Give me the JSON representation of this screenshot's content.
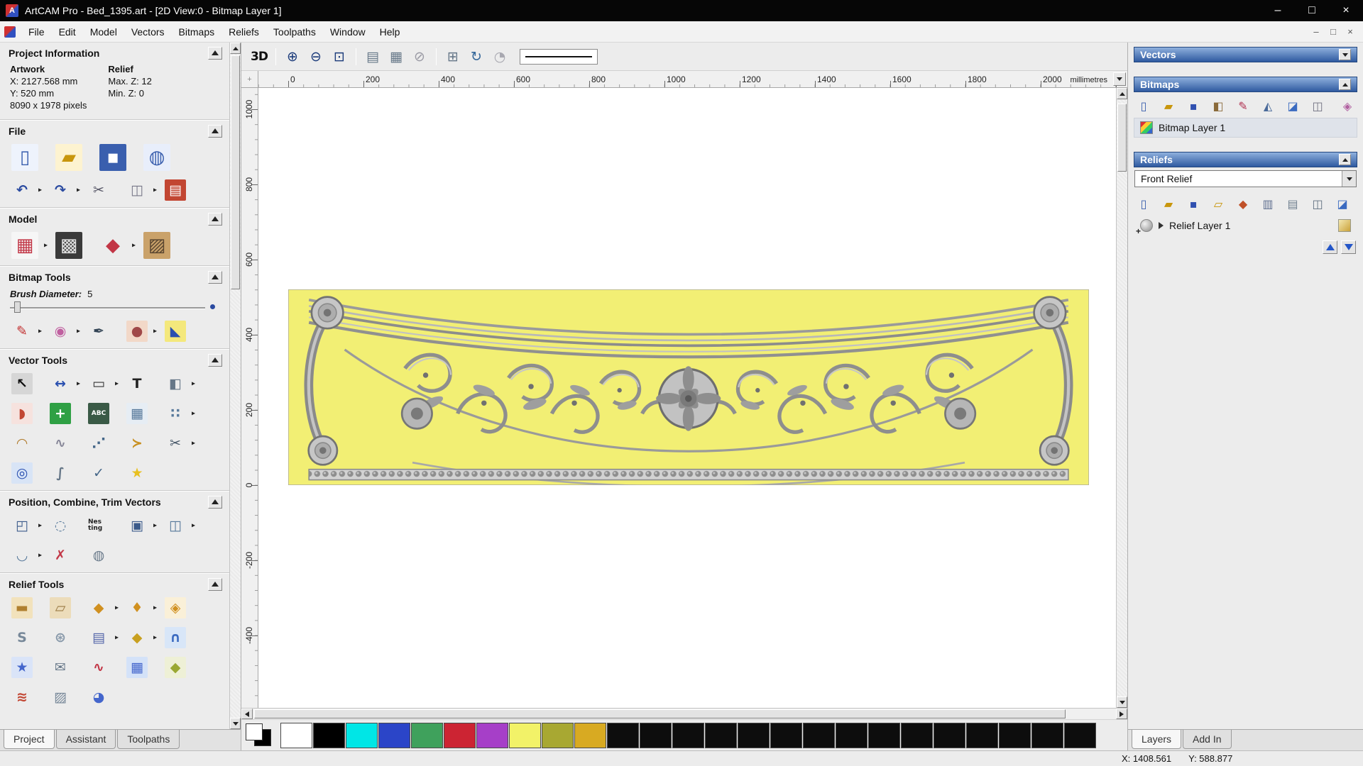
{
  "window": {
    "title": "ArtCAM Pro - Bed_1395.art - [2D View:0 - Bitmap Layer 1]",
    "app_initial": "A",
    "controls": {
      "minimize": "–",
      "restore": "□",
      "close": "×"
    },
    "mdi": {
      "minimize": "–",
      "restore": "□",
      "close": "×"
    }
  },
  "menu": {
    "items": [
      "File",
      "Edit",
      "Model",
      "Vectors",
      "Bitmaps",
      "Reliefs",
      "Toolpaths",
      "Window",
      "Help"
    ]
  },
  "left_panel": {
    "project_information": {
      "title": "Project Information",
      "artwork_label": "Artwork",
      "relief_label": "Relief",
      "artwork_rows": [
        "X: 2127.568 mm",
        "Y: 520 mm",
        "8090 x 1978 pixels"
      ],
      "relief_rows": [
        "Max. Z: 12",
        "Min. Z: 0"
      ]
    },
    "file": {
      "title": "File",
      "row1": [
        {
          "name": "new-model-icon",
          "glyph": "▯",
          "fg": "#3a5fae",
          "bg": "#eef3fc"
        },
        {
          "name": "open-model-icon",
          "glyph": "▰",
          "fg": "#c8960c",
          "bg": "#fdf3d0"
        },
        {
          "name": "save-model-icon",
          "glyph": "▪",
          "fg": "#ffffff",
          "bg": "#3a5fae"
        },
        {
          "name": "import-model-icon",
          "glyph": "◍",
          "fg": "#3a5fae",
          "bg": "#e8eefb"
        }
      ],
      "row2": [
        {
          "name": "undo-icon",
          "glyph": "↶",
          "fg": "#2a4aa0",
          "arrow": "▸"
        },
        {
          "name": "redo-icon",
          "glyph": "↷",
          "fg": "#2a4aa0",
          "arrow": "▸"
        },
        {
          "name": "cut-icon",
          "glyph": "✂",
          "fg": "#555566"
        },
        {
          "name": "copy-icon",
          "glyph": "◫",
          "fg": "#777788",
          "arrow": "▸"
        },
        {
          "name": "paste-notes-icon",
          "glyph": "▤",
          "fg": "#ffffff",
          "bg": "#c24632"
        }
      ]
    },
    "model": {
      "title": "Model",
      "icons": [
        {
          "name": "set-model-size-icon",
          "glyph": "▦",
          "fg": "#c23646",
          "bg": "#f6f6f6",
          "arrow": "▸"
        },
        {
          "name": "adjust-model-icon",
          "glyph": "▩",
          "fg": "#e0e0e0",
          "bg": "#3a3a3a"
        },
        {
          "name": "model-lighting-icon",
          "glyph": "◆",
          "fg": "#c23646",
          "arrow": "▸"
        },
        {
          "name": "load-reference-icon",
          "glyph": "▨",
          "fg": "#5a4630",
          "bg": "#caa26a"
        }
      ]
    },
    "bitmap_tools": {
      "title": "Bitmap Tools",
      "brush_label": "Brush Diameter:",
      "brush_value": "5",
      "icons": [
        {
          "name": "paint-brush-icon",
          "glyph": "✎",
          "fg": "#c23232",
          "arrow": "▸"
        },
        {
          "name": "paint-selected-icon",
          "glyph": "◉",
          "fg": "#c060a0",
          "arrow": "▸"
        },
        {
          "name": "eyedropper-icon",
          "glyph": "✒",
          "fg": "#334455"
        },
        {
          "name": "palette-icon",
          "glyph": "●",
          "fg": "#a04848",
          "bg": "#f2d8c8",
          "arrow": "▸"
        },
        {
          "name": "flood-fill-icon",
          "glyph": "◣",
          "fg": "#2a50b0",
          "bg": "#f4e87c"
        }
      ]
    },
    "vector_tools": {
      "title": "Vector Tools",
      "row1": [
        {
          "name": "select-vectors-icon",
          "glyph": "↖",
          "fg": "#111111",
          "bg": "#d6d6d6"
        },
        {
          "name": "transform-vectors-icon",
          "glyph": "↔",
          "fg": "#2a50b0",
          "arrow": "▸"
        },
        {
          "name": "create-rectangle-icon",
          "glyph": "▭",
          "fg": "#333333",
          "arrow": "▸"
        },
        {
          "name": "create-text-icon",
          "glyph": "T",
          "fg": "#222222"
        },
        {
          "name": "mirror-vectors-icon",
          "glyph": "◧",
          "fg": "#667788",
          "arrow": "▸"
        }
      ],
      "row2": [
        {
          "name": "vector-boundary-icon",
          "glyph": "◗",
          "fg": "#c24632",
          "bg": "#f6e2de"
        },
        {
          "name": "bitmap-to-vector-icon",
          "glyph": "+",
          "fg": "#ffffff",
          "bg": "#2fa044"
        },
        {
          "name": "vector-text-block-icon",
          "glyph": "ABC",
          "fg": "#ffffff",
          "bg": "#3a5a46"
        },
        {
          "name": "fence-vectors-icon",
          "glyph": "▦",
          "fg": "#56789a",
          "bg": "#e6edf4"
        },
        {
          "name": "scatter-vectors-icon",
          "glyph": "∷",
          "fg": "#56789a",
          "arrow": "▸"
        }
      ],
      "row3": [
        {
          "name": "fit-arc-icon",
          "glyph": "◠",
          "fg": "#b07a2a"
        },
        {
          "name": "smooth-polyline-icon",
          "glyph": "∿",
          "fg": "#888899"
        },
        {
          "name": "node-edit-icon",
          "glyph": "⋰",
          "fg": "#446688"
        },
        {
          "name": "reverse-vector-icon",
          "glyph": "≻",
          "fg": "#c89020"
        },
        {
          "name": "trim-vector-icon",
          "glyph": "✂",
          "fg": "#445566",
          "arrow": "▸"
        }
      ],
      "row4": [
        {
          "name": "create-ring-icon",
          "glyph": "◎",
          "fg": "#2a50b0",
          "bg": "#d8e4f6"
        },
        {
          "name": "free-curve-icon",
          "glyph": "∫",
          "fg": "#667788"
        },
        {
          "name": "vector-doctor-icon",
          "glyph": "✓",
          "fg": "#446688"
        },
        {
          "name": "create-star-icon",
          "glyph": "★",
          "fg": "#e8c020"
        }
      ]
    },
    "position_tools": {
      "title": "Position, Combine, Trim Vectors",
      "row1": [
        {
          "name": "block-copy-icon",
          "glyph": "◰",
          "fg": "#3a5a8a",
          "arrow": "▸"
        },
        {
          "name": "rotate-copy-icon",
          "glyph": "◌",
          "fg": "#56789a"
        },
        {
          "name": "nesting-icon",
          "glyph": "Nes ting",
          "fg": "#222222"
        },
        {
          "name": "align-vectors-icon",
          "glyph": "▣",
          "fg": "#3a5a8a",
          "arrow": "▸"
        },
        {
          "name": "group-vectors-icon",
          "glyph": "◫",
          "fg": "#56789a",
          "arrow": "▸"
        }
      ],
      "row2": [
        {
          "name": "weld-vectors-icon",
          "glyph": "◡",
          "fg": "#56789a",
          "arrow": "▸"
        },
        {
          "name": "trim-weld-icon",
          "glyph": "✗",
          "fg": "#c23646"
        },
        {
          "name": "spin-copy-icon",
          "glyph": "◍",
          "fg": "#667788"
        }
      ]
    },
    "relief_tools": {
      "title": "Relief Tools",
      "row1": [
        {
          "name": "sculpt-icon",
          "glyph": "▬",
          "fg": "#b08030",
          "bg": "#f2e2bc"
        },
        {
          "name": "smooth-relief-icon",
          "glyph": "▱",
          "fg": "#9a7a44",
          "bg": "#ecdcba"
        },
        {
          "name": "shape-editor-icon",
          "glyph": "◆",
          "fg": "#d09020",
          "arrow": "▸"
        },
        {
          "name": "add-clipart-icon",
          "glyph": "♦",
          "fg": "#d09020",
          "arrow": "▸"
        },
        {
          "name": "relief-clipart-icon",
          "glyph": "◈",
          "fg": "#d09020",
          "bg": "#faf0d8"
        }
      ],
      "row2": [
        {
          "name": "sweep-profile-icon",
          "glyph": "S",
          "fg": "#778899"
        },
        {
          "name": "weave-wizard-icon",
          "glyph": "⊛",
          "fg": "#8899aa"
        },
        {
          "name": "offset-relief-icon",
          "glyph": "▤",
          "fg": "#5566aa",
          "arrow": "▸"
        },
        {
          "name": "paste-relief-icon",
          "glyph": "◆",
          "fg": "#c8a020",
          "arrow": "▸"
        },
        {
          "name": "unlock-relief-icon",
          "glyph": "∩",
          "fg": "#3a6ac0",
          "bg": "#d8e6f8"
        }
      ],
      "row3": [
        {
          "name": "texture-relief-icon",
          "glyph": "★",
          "fg": "#4466cc",
          "bg": "#dae4f8"
        },
        {
          "name": "envelope-relief-icon",
          "glyph": "✉",
          "fg": "#667788"
        },
        {
          "name": "wave-relief-icon",
          "glyph": "∿",
          "fg": "#c23646"
        },
        {
          "name": "emboss-relief-icon",
          "glyph": "▦",
          "fg": "#4466cc",
          "bg": "#d4e2f8"
        },
        {
          "name": "extrude-relief-icon",
          "glyph": "◆",
          "fg": "#9aa832",
          "bg": "#eef0d6"
        }
      ],
      "row4": [
        {
          "name": "two-rail-sweep-icon",
          "glyph": "≋",
          "fg": "#c24632"
        },
        {
          "name": "fade-relief-icon",
          "glyph": "▨",
          "fg": "#778899"
        },
        {
          "name": "turn-relief-icon",
          "glyph": "◕",
          "fg": "#4466cc"
        }
      ]
    },
    "tabs": [
      "Project",
      "Assistant",
      "Toolpaths"
    ]
  },
  "toolbar": {
    "view3d_label": "3D",
    "group1": [
      {
        "name": "zoom-in-icon",
        "glyph": "⊕",
        "fg": "#1a3a7a"
      },
      {
        "name": "zoom-out-icon",
        "glyph": "⊖",
        "fg": "#1a3a7a"
      },
      {
        "name": "zoom-window-icon",
        "glyph": "⊡",
        "fg": "#1a3a7a"
      }
    ],
    "group2": [
      {
        "name": "zoom-page-icon",
        "glyph": "▤",
        "fg": "#667788"
      },
      {
        "name": "zoom-objects-icon",
        "glyph": "▦",
        "fg": "#667788"
      },
      {
        "name": "zoom-previous-icon",
        "glyph": "⊘",
        "fg": "#9a9aa4"
      }
    ],
    "group3": [
      {
        "name": "pan-view-icon",
        "glyph": "⊞",
        "fg": "#667788"
      },
      {
        "name": "redraw-view-icon",
        "glyph": "↻",
        "fg": "#336699"
      },
      {
        "name": "zoom-disabled-icon",
        "glyph": "◔",
        "fg": "#a8a8b0"
      }
    ]
  },
  "rulers": {
    "unit": "millimetres",
    "h_ticks": [
      "0",
      "200",
      "400",
      "600",
      "800",
      "1000",
      "1200",
      "1400",
      "1600",
      "1800",
      "2000"
    ],
    "v_ticks": [
      "1000",
      "800",
      "600",
      "400",
      "200",
      "0",
      "-200",
      "-400"
    ]
  },
  "right_panel": {
    "vectors": {
      "title": "Vectors"
    },
    "bitmaps": {
      "title": "Bitmaps",
      "layer_label": "Bitmap Layer 1",
      "icons": [
        {
          "name": "new-bitmap-icon",
          "glyph": "▯",
          "fg": "#3a5fae"
        },
        {
          "name": "open-bitmap-icon",
          "glyph": "▰",
          "fg": "#c8960c"
        },
        {
          "name": "save-bitm ap-icon",
          "glyph": "▪",
          "fg": "#3050b0"
        },
        {
          "name": "bitmap-contrast-icon",
          "glyph": "◧",
          "fg": "#8a6a3a"
        },
        {
          "name": "draw-bitmap-icon",
          "glyph": "✎",
          "fg": "#b03050"
        },
        {
          "name": "bitmap-to-vector-icon",
          "glyph": "◭",
          "fg": "#4a6a9a"
        },
        {
          "name": "bitmap-transparency-icon",
          "glyph": "◪",
          "fg": "#3a6ac0"
        },
        {
          "name": "delete-bitmap-icon",
          "glyph": "◫",
          "fg": "#707080"
        },
        {
          "name": "bitmap-options-icon",
          "glyph": "◈",
          "fg": "#b060a0"
        }
      ]
    },
    "reliefs": {
      "title": "Reliefs",
      "combo_value": "Front Relief",
      "layer_label": "Relief Layer 1",
      "add_overlay": "+",
      "icons": [
        {
          "name": "new-relief-icon",
          "glyph": "▯",
          "fg": "#3a5fae"
        },
        {
          "name": "open-relief-icon",
          "glyph": "▰",
          "fg": "#c8960c"
        },
        {
          "name": "save-relief-icon",
          "glyph": "▪",
          "fg": "#3050b0"
        },
        {
          "name": "import-relief-icon",
          "glyph": "▱",
          "fg": "#c8960c"
        },
        {
          "name": "calculate-relief-icon",
          "glyph": "◆",
          "fg": "#c05028"
        },
        {
          "name": "preview-relief-icon",
          "glyph": "▥",
          "fg": "#607090"
        },
        {
          "name": "reset-relief-icon",
          "glyph": "▤",
          "fg": "#708090"
        },
        {
          "name": "delete-relief-icon",
          "glyph": "◫",
          "fg": "#607080"
        },
        {
          "name": "smooth-relief-small-icon",
          "glyph": "◪",
          "fg": "#3a6ac0"
        },
        {
          "name": "relief-options-icon",
          "glyph": "◈",
          "fg": "#b060a0"
        }
      ]
    },
    "tabs": [
      "Layers",
      "Add In"
    ]
  },
  "palette": {
    "primary": "#ffffff",
    "secondary": "#000000",
    "colors": [
      "#ffffff",
      "#000000",
      "#00e6e6",
      "#2b45c8",
      "#3fa15c",
      "#cc2433",
      "#a63fc8",
      "#f2f268",
      "#a8a832",
      "#d8aa22",
      "#0d0d0d",
      "#0d0d0d",
      "#0d0d0d",
      "#0d0d0d",
      "#0d0d0d",
      "#0d0d0d",
      "#0d0d0d",
      "#0d0d0d",
      "#0d0d0d",
      "#0d0d0d",
      "#0d0d0d",
      "#0d0d0d",
      "#0d0d0d",
      "#0d0d0d",
      "#0d0d0d"
    ]
  },
  "statusbar": {
    "x": "X: 1408.561",
    "y": "Y: 588.877"
  }
}
